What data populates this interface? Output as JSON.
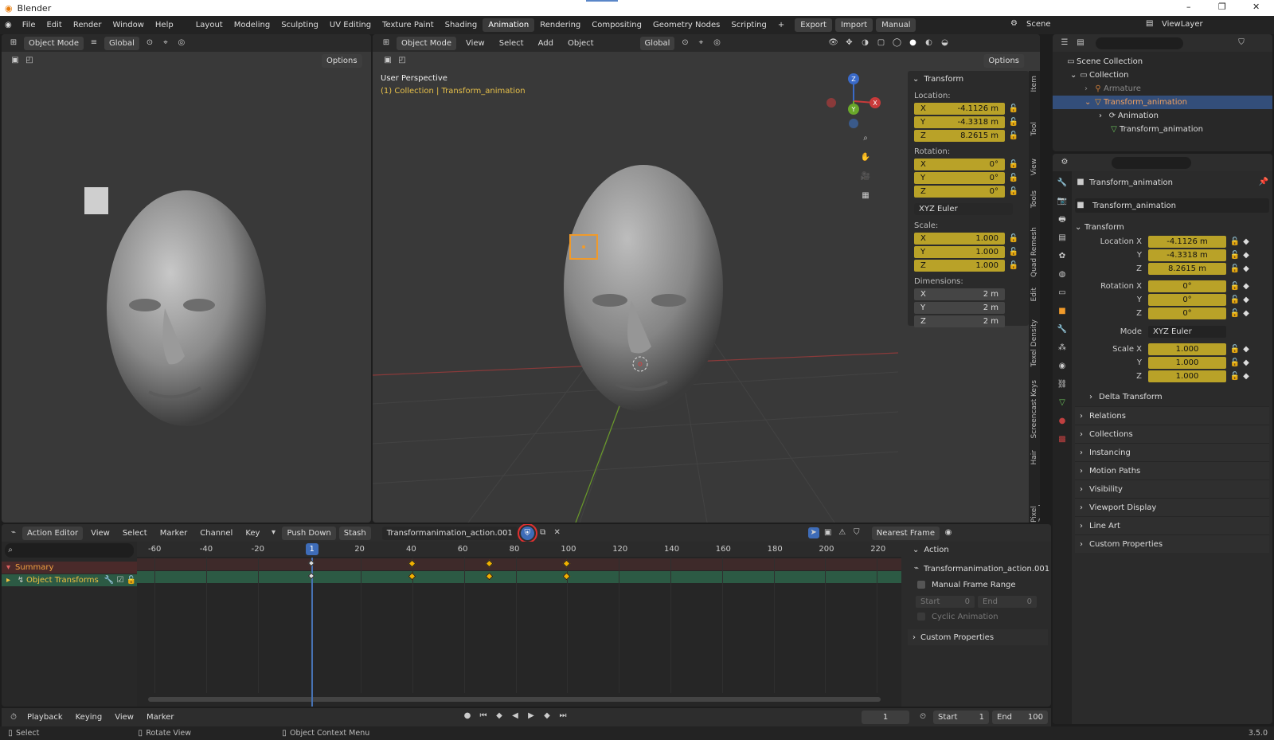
{
  "window": {
    "title": "Blender",
    "min": "–",
    "max": "❐",
    "close": "✕"
  },
  "menu": [
    "File",
    "Edit",
    "Render",
    "Window",
    "Help"
  ],
  "workspaces": [
    "Layout",
    "Modeling",
    "Sculpting",
    "UV Editing",
    "Texture Paint",
    "Shading",
    "Animation",
    "Rendering",
    "Compositing",
    "Geometry Nodes",
    "Scripting"
  ],
  "toprow": {
    "add": "+",
    "export": "Export",
    "import": "Import",
    "manual": "Manual",
    "scene": "Scene",
    "viewlayer": "ViewLayer"
  },
  "left_vp": {
    "mode": "Object Mode",
    "orient": "Global",
    "options": "Options"
  },
  "main_vp": {
    "mode": "Object Mode",
    "view": "View",
    "select": "Select",
    "add": "Add",
    "object": "Object",
    "orient": "Global",
    "options": "Options",
    "perspective": "User Perspective",
    "collection": "(1) Collection | Transform_animation",
    "gizmo_x": "X",
    "gizmo_y": "Y",
    "gizmo_z": "Z"
  },
  "npanel": {
    "transform": "Transform",
    "location": "Location:",
    "rotation": "Rotation:",
    "scale": "Scale:",
    "dimensions": "Dimensions:",
    "loc": [
      "-4.1126 m",
      "-4.3318 m",
      "8.2615 m"
    ],
    "rot": [
      "0°",
      "0°",
      "0°"
    ],
    "mode": "XYZ Euler",
    "scl": [
      "1.000",
      "1.000",
      "1.000"
    ],
    "dim": [
      "2 m",
      "2 m",
      "2 m"
    ],
    "axes": [
      "X",
      "Y",
      "Z"
    ],
    "tabs": [
      "Item",
      "Tool",
      "View",
      "Tools",
      "Quad Remesh",
      "Edit",
      "Texel Density",
      "Screencast Keys",
      "Hair",
      "Pixel Render"
    ]
  },
  "outliner": {
    "scene_collection": "Scene Collection",
    "collection": "Collection",
    "armature": "Armature",
    "transform_animation": "Transform_animation",
    "animation": "Animation",
    "mesh": "Transform_animation"
  },
  "props": {
    "object": "Transform_animation",
    "data": "Transform_animation",
    "transform": "Transform",
    "loc_x": "Location X",
    "loc": [
      "-4.1126 m",
      "-4.3318 m",
      "8.2615 m"
    ],
    "rot_x": "Rotation X",
    "rot": [
      "0°",
      "0°",
      "0°"
    ],
    "mode_lbl": "Mode",
    "mode": "XYZ Euler",
    "scale_x": "Scale X",
    "scl": [
      "1.000",
      "1.000",
      "1.000"
    ],
    "y": "Y",
    "z": "Z",
    "sections": [
      "Delta Transform",
      "Relations",
      "Collections",
      "Instancing",
      "Motion Paths",
      "Visibility",
      "Viewport Display",
      "Line Art",
      "Custom Properties"
    ]
  },
  "action_editor": {
    "mode": "Action Editor",
    "view": "View",
    "select": "Select",
    "marker": "Marker",
    "channel": "Channel",
    "key": "Key",
    "pushdown": "Push Down",
    "stash": "Stash",
    "action": "Transformanimation_action.001",
    "snap": "Nearest Frame",
    "ticks": [
      "-60",
      "-40",
      "-20",
      "1",
      "20",
      "40",
      "60",
      "80",
      "100",
      "120",
      "140",
      "160",
      "180",
      "200",
      "220"
    ],
    "summary": "Summary",
    "channel_name": "Object Transforms",
    "keyframes": [
      1,
      40,
      70,
      100
    ]
  },
  "action_panel": {
    "title": "Action",
    "name": "Transformanimation_action.001",
    "manual": "Manual Frame Range",
    "start": "Start",
    "start_v": "0",
    "end": "End",
    "end_v": "0",
    "cyclic": "Cyclic Animation",
    "custom": "Custom Properties"
  },
  "timeline": {
    "playback": "Playback",
    "keying": "Keying",
    "view": "View",
    "marker": "Marker",
    "frame": "1",
    "start": "Start",
    "start_v": "1",
    "end": "End",
    "end_v": "100"
  },
  "status": {
    "select": "Select",
    "rotate": "Rotate View",
    "context": "Object Context Menu",
    "version": "3.5.0"
  }
}
